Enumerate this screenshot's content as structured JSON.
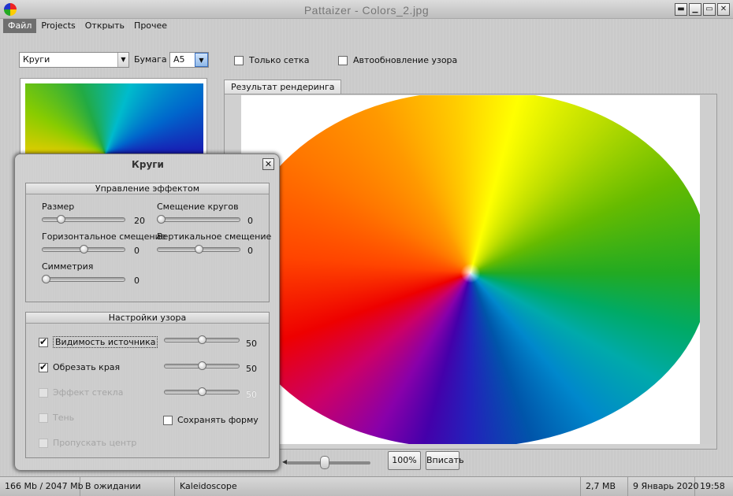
{
  "window": {
    "title": "Pattaizer - Colors_2.jpg",
    "controls": [
      "▬",
      "▭",
      "✕"
    ]
  },
  "menu": [
    "Файл",
    "Projects",
    "Открыть",
    "Прочее"
  ],
  "toolbar": {
    "effect_value": "Круги",
    "paper_label": "Бумага",
    "paper_value": "A5",
    "grid_only_label": "Только сетка",
    "auto_update_label": "Автообновление узора"
  },
  "render": {
    "tab_label": "Результат рендеринга"
  },
  "bottom": {
    "zoom_button": "100%",
    "fit_button": "Вписать",
    "slider_level": 0.45
  },
  "status": {
    "memory": "166 Mb / 2047 Mb",
    "state": "В ожидании",
    "effect": "Kaleidoscope",
    "size": "2,7 MB",
    "date": "9 Январь 2020",
    "time": "19:58"
  },
  "dialog": {
    "title": "Круги",
    "effect_group": {
      "heading": "Управление эффектом",
      "size": {
        "label": "Размер",
        "value": "20",
        "level": 0.2
      },
      "offset": {
        "label": "Смещение кругов",
        "value": "0",
        "level": 0.0
      },
      "hshift": {
        "label": "Горизонтальное смещение",
        "value": "0",
        "level": 0.5
      },
      "vshift": {
        "label": "Вертикальное смещение",
        "value": "0",
        "level": 0.5
      },
      "symmetry": {
        "label": "Симметрия",
        "value": "0",
        "level": 0.0
      }
    },
    "pattern_group": {
      "heading": "Настройки узора",
      "source_visibility": {
        "label": "Видимость источника",
        "checked": true,
        "value": "50"
      },
      "crop_edges": {
        "label": "Обрезать края",
        "checked": true,
        "value": "50"
      },
      "glass_effect": {
        "label": "Эффект стекла",
        "checked": false,
        "value": "50"
      },
      "shadow": {
        "label": "Тень",
        "checked": false
      },
      "skip_center": {
        "label": "Пропускать центр",
        "checked": false
      },
      "keep_shape": {
        "label": "Сохранять форму",
        "checked": false
      }
    }
  }
}
